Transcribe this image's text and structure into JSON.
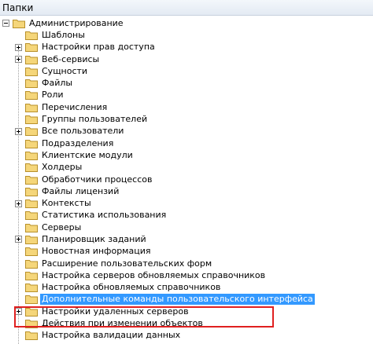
{
  "panel": {
    "title": "Папки"
  },
  "tree": {
    "root": {
      "label": "Администрирование",
      "expanded": true
    },
    "items": [
      {
        "label": "Шаблоны",
        "expander": "none"
      },
      {
        "label": "Настройки прав доступа",
        "expander": "plus"
      },
      {
        "label": "Веб-сервисы",
        "expander": "plus"
      },
      {
        "label": "Сущности",
        "expander": "none"
      },
      {
        "label": "Файлы",
        "expander": "none"
      },
      {
        "label": "Роли",
        "expander": "none"
      },
      {
        "label": "Перечисления",
        "expander": "none"
      },
      {
        "label": "Группы пользователей",
        "expander": "none"
      },
      {
        "label": "Все пользователи",
        "expander": "plus"
      },
      {
        "label": "Подразделения",
        "expander": "none"
      },
      {
        "label": "Клиентские модули",
        "expander": "none"
      },
      {
        "label": "Холдеры",
        "expander": "none"
      },
      {
        "label": "Обработчики процессов",
        "expander": "none"
      },
      {
        "label": "Файлы лицензий",
        "expander": "none"
      },
      {
        "label": "Контексты",
        "expander": "plus"
      },
      {
        "label": "Статистика использования",
        "expander": "none"
      },
      {
        "label": "Серверы",
        "expander": "none"
      },
      {
        "label": "Планировщик заданий",
        "expander": "plus"
      },
      {
        "label": "Новостная информация",
        "expander": "none"
      },
      {
        "label": "Расширение пользовательских форм",
        "expander": "none"
      },
      {
        "label": "Настройка серверов обновляемых справочников",
        "expander": "none"
      },
      {
        "label": "Настройка обновляемых справочников",
        "expander": "none"
      },
      {
        "label": "Дополнительные команды пользовательского интерфейса",
        "expander": "none",
        "selected": true
      },
      {
        "label": "Настройки удаленных серверов",
        "expander": "plus"
      },
      {
        "label": "Действия при изменении объектов",
        "expander": "none"
      },
      {
        "label": "Настройка валидации данных",
        "expander": "none"
      }
    ]
  },
  "colors": {
    "selection": "#3399ff",
    "highlight_border": "#e02020",
    "folder_fill": "#f5d67a",
    "folder_stroke": "#b8902a"
  },
  "icons": {
    "folder": "folder-icon",
    "expand": "plus-expander-icon",
    "collapse": "minus-expander-icon"
  }
}
